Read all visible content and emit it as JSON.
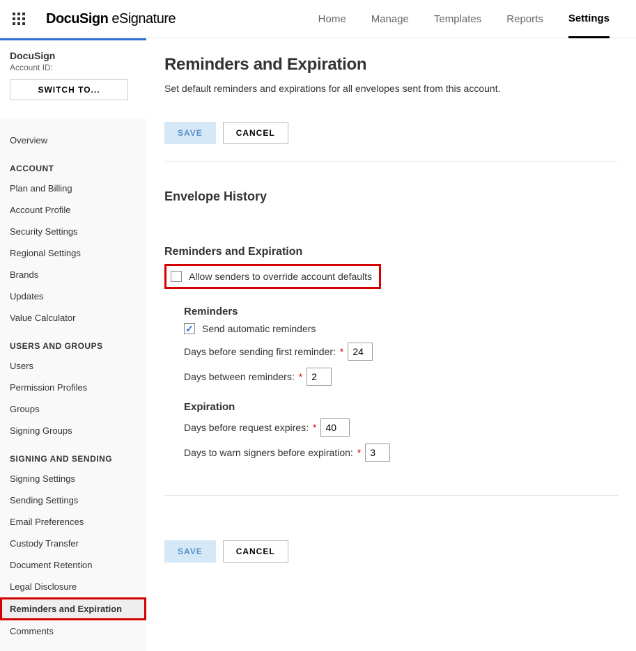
{
  "brand": {
    "bold": "DocuSign",
    "thin": " eSignature"
  },
  "topnav": {
    "home": "Home",
    "manage": "Manage",
    "templates": "Templates",
    "reports": "Reports",
    "settings": "Settings"
  },
  "sidebar": {
    "title": "DocuSign",
    "account_id_label": "Account ID:",
    "switch_to": "SWITCH TO...",
    "overview": "Overview",
    "sections": {
      "account": {
        "title": "ACCOUNT",
        "items": {
          "plan_billing": "Plan and Billing",
          "account_profile": "Account Profile",
          "security_settings": "Security Settings",
          "regional_settings": "Regional Settings",
          "brands": "Brands",
          "updates": "Updates",
          "value_calculator": "Value Calculator"
        }
      },
      "users_groups": {
        "title": "USERS AND GROUPS",
        "items": {
          "users": "Users",
          "permission_profiles": "Permission Profiles",
          "groups": "Groups",
          "signing_groups": "Signing Groups"
        }
      },
      "signing_sending": {
        "title": "SIGNING AND SENDING",
        "items": {
          "signing_settings": "Signing Settings",
          "sending_settings": "Sending Settings",
          "email_preferences": "Email Preferences",
          "custody_transfer": "Custody Transfer",
          "document_retention": "Document Retention",
          "legal_disclosure": "Legal Disclosure",
          "reminders_expiration": "Reminders and Expiration",
          "comments": "Comments"
        }
      }
    }
  },
  "main": {
    "title": "Reminders and Expiration",
    "description": "Set default reminders and expirations for all envelopes sent from this account.",
    "save": "SAVE",
    "cancel": "CANCEL",
    "envelope_history": "Envelope History",
    "rem_exp_heading": "Reminders and Expiration",
    "allow_override": "Allow senders to override account defaults",
    "reminders": {
      "heading": "Reminders",
      "send_auto": "Send automatic reminders",
      "first_label": "Days before sending first reminder:",
      "first_value": "24",
      "between_label": "Days between reminders:",
      "between_value": "2"
    },
    "expiration": {
      "heading": "Expiration",
      "expires_label": "Days before request expires:",
      "expires_value": "40",
      "warn_label": "Days to warn signers before expiration:",
      "warn_value": "3"
    }
  }
}
